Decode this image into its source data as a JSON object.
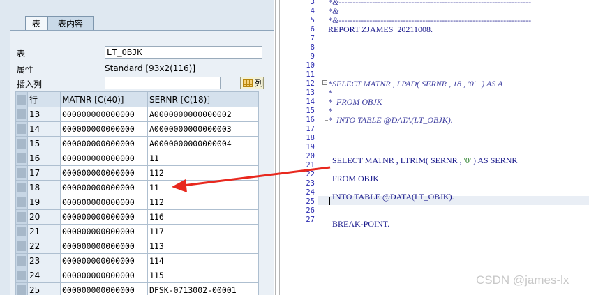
{
  "tabs": [
    {
      "label": "表"
    },
    {
      "label": "表内容"
    }
  ],
  "fields": {
    "table_label": "表",
    "table_value": "LT_OBJK",
    "attr_label": "属性",
    "attr_value": "Standard [93x2(116)]",
    "insert_label": "插入列",
    "insert_value": "",
    "column_button_label": "列"
  },
  "grid": {
    "headers": [
      "行",
      "MATNR [C(40)]",
      "SERNR [C(18)]"
    ],
    "rows": [
      {
        "row": "13",
        "matnr": "000000000000000",
        "sernr": "A0000000000000002"
      },
      {
        "row": "14",
        "matnr": "000000000000000",
        "sernr": "A0000000000000003"
      },
      {
        "row": "15",
        "matnr": "000000000000000",
        "sernr": "A0000000000000004"
      },
      {
        "row": "16",
        "matnr": "000000000000000",
        "sernr": "11"
      },
      {
        "row": "17",
        "matnr": "000000000000000",
        "sernr": "112"
      },
      {
        "row": "18",
        "matnr": "000000000000000",
        "sernr": "11"
      },
      {
        "row": "19",
        "matnr": "000000000000000",
        "sernr": "112"
      },
      {
        "row": "20",
        "matnr": "000000000000000",
        "sernr": "116"
      },
      {
        "row": "21",
        "matnr": "000000000000000",
        "sernr": "117"
      },
      {
        "row": "22",
        "matnr": "000000000000000",
        "sernr": "113"
      },
      {
        "row": "23",
        "matnr": "000000000000000",
        "sernr": "114"
      },
      {
        "row": "24",
        "matnr": "000000000000000",
        "sernr": "115"
      },
      {
        "row": "25",
        "matnr": "000000000000000",
        "sernr": "DFSK-0713002-00001"
      }
    ]
  },
  "editor": {
    "top_dashes": "*&---------------------------------------------------------------------",
    "lines": [
      {
        "n": "3",
        "text": "*&---------------------------------------------------------------------",
        "type": "cm"
      },
      {
        "n": "4",
        "text": "*&",
        "type": "cm"
      },
      {
        "n": "5",
        "text": "*&---------------------------------------------------------------------",
        "type": "cm"
      },
      {
        "n": "6",
        "text": "REPORT ZJAMES_20211008.",
        "type": "code"
      },
      {
        "n": "7",
        "text": "",
        "type": "code"
      },
      {
        "n": "8",
        "text": "",
        "type": "code"
      },
      {
        "n": "9",
        "text": "",
        "type": "code"
      },
      {
        "n": "10",
        "text": "",
        "type": "code"
      },
      {
        "n": "11",
        "text": "",
        "type": "code"
      },
      {
        "n": "12",
        "text": "*SELECT MATNR , LPAD( SERNR , 18 , '0'   ) AS A",
        "type": "cm"
      },
      {
        "n": "13",
        "text": "*",
        "type": "cm"
      },
      {
        "n": "14",
        "text": "*  FROM OBJK",
        "type": "cm"
      },
      {
        "n": "15",
        "text": "*",
        "type": "cm"
      },
      {
        "n": "16",
        "text": "*  INTO TABLE @DATA(LT_OBJK).",
        "type": "cm"
      },
      {
        "n": "17",
        "text": "",
        "type": "code"
      },
      {
        "n": "18",
        "text": "",
        "type": "code"
      },
      {
        "n": "19",
        "text": "",
        "type": "code"
      },
      {
        "n": "20",
        "text": "  SELECT MATNR , LTRIM( SERNR , '0' ) AS SERNR",
        "type": "code"
      },
      {
        "n": "21",
        "text": "",
        "type": "code"
      },
      {
        "n": "22",
        "text": "  FROM OBJK",
        "type": "code"
      },
      {
        "n": "23",
        "text": "",
        "type": "code"
      },
      {
        "n": "24",
        "text": "  INTO TABLE @DATA(LT_OBJK).",
        "type": "code"
      },
      {
        "n": "25",
        "text": "",
        "type": "code"
      },
      {
        "n": "26",
        "text": "",
        "type": "code"
      },
      {
        "n": "27",
        "text": "  BREAK-POINT.",
        "type": "code"
      }
    ]
  },
  "watermark": "CSDN @james-lx",
  "colors": {
    "arrow": "#e8281e",
    "keyword": "#1a1a8c",
    "line_numbers": "#2b2bb0"
  }
}
